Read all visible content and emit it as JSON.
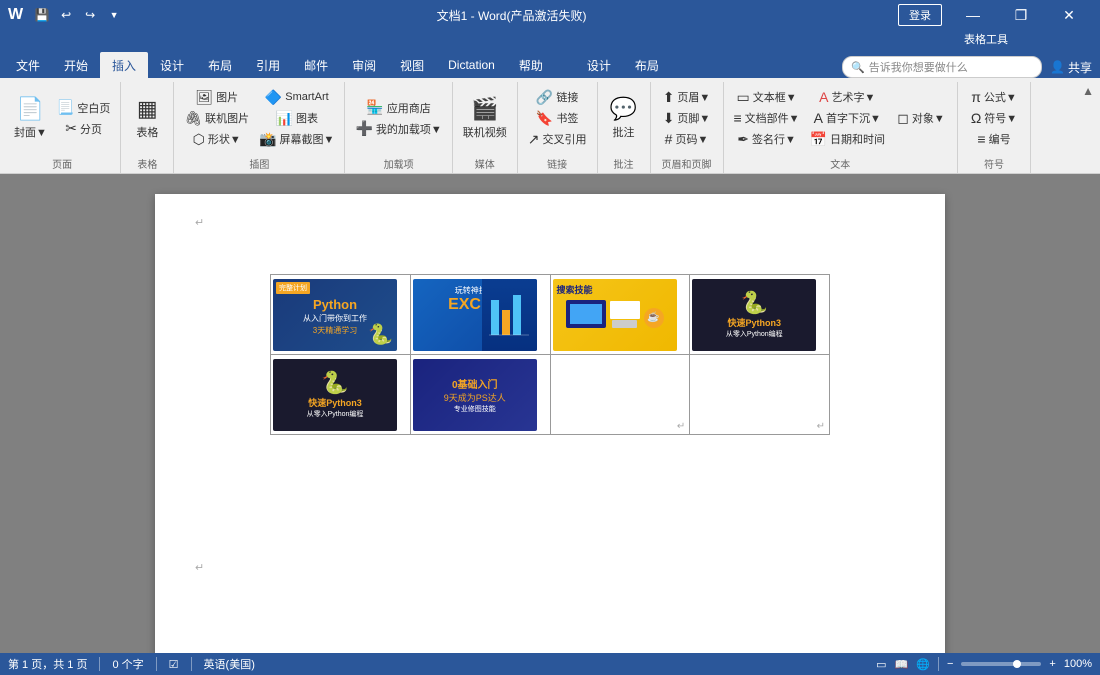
{
  "titlebar": {
    "title": "文档1 - Word(产品激活失败)",
    "table_tools": "表格工具",
    "login_label": "登录",
    "share_label": "共享",
    "minimize": "—",
    "restore": "❐",
    "close": "✕"
  },
  "qat": {
    "save": "💾",
    "undo": "↩",
    "redo": "↪",
    "custom": "▼"
  },
  "ribbon_tabs": {
    "file": "文件",
    "home": "开始",
    "insert": "插入",
    "design": "设计",
    "layout": "布局",
    "references": "引用",
    "mailings": "邮件",
    "review": "审阅",
    "view": "视图",
    "dictation": "Dictation",
    "help": "帮助",
    "table_design": "设计",
    "table_layout": "布局",
    "search_placeholder": "告诉我你想要做什么"
  },
  "ribbon": {
    "groups": [
      {
        "label": "页面",
        "items": [
          {
            "icon": "📄",
            "text": "封面▼",
            "type": "big"
          },
          {
            "icon": "📃",
            "text": "空白页",
            "type": "small"
          },
          {
            "icon": "✂",
            "text": "分页",
            "type": "small"
          }
        ]
      },
      {
        "label": "表格",
        "items": [
          {
            "icon": "▦",
            "text": "表格",
            "type": "big"
          }
        ]
      },
      {
        "label": "插图",
        "items": [
          {
            "icon": "🖼",
            "text": "图片",
            "type": "small"
          },
          {
            "icon": "🖇",
            "text": "联机图片",
            "type": "small"
          },
          {
            "icon": "⬡",
            "text": "形状▼",
            "type": "small"
          },
          {
            "icon": "🔷",
            "text": "SmartArt",
            "type": "small"
          },
          {
            "icon": "📊",
            "text": "图表",
            "type": "small"
          },
          {
            "icon": "📸",
            "text": "屏幕截图▼",
            "type": "small"
          }
        ]
      },
      {
        "label": "加载项",
        "items": [
          {
            "icon": "🏪",
            "text": "应用商店",
            "type": "small"
          },
          {
            "icon": "➕",
            "text": "我的加载项▼",
            "type": "small"
          }
        ]
      },
      {
        "label": "媒体",
        "items": [
          {
            "icon": "🎬",
            "text": "联机视频",
            "type": "big"
          }
        ]
      },
      {
        "label": "链接",
        "items": [
          {
            "icon": "🔗",
            "text": "链接",
            "type": "small"
          },
          {
            "icon": "🔖",
            "text": "书签",
            "type": "small"
          },
          {
            "icon": "↗",
            "text": "交叉引用",
            "type": "small"
          }
        ]
      },
      {
        "label": "批注",
        "items": [
          {
            "icon": "💬",
            "text": "批注",
            "type": "big"
          }
        ]
      },
      {
        "label": "页眉和页脚",
        "items": [
          {
            "icon": "⬆",
            "text": "页眉▼",
            "type": "small"
          },
          {
            "icon": "⬇",
            "text": "页脚▼",
            "type": "small"
          },
          {
            "icon": "#",
            "text": "页码▼",
            "type": "small"
          }
        ]
      },
      {
        "label": "文本",
        "items": [
          {
            "icon": "▭",
            "text": "文本框▼",
            "type": "small"
          },
          {
            "icon": "A",
            "text": "艺术字▼",
            "type": "small"
          },
          {
            "icon": "A",
            "text": "首字下沉▼",
            "type": "small"
          },
          {
            "icon": "≡",
            "text": "文档部件▼",
            "type": "small"
          },
          {
            "icon": "✒",
            "text": "签名行▼",
            "type": "small"
          },
          {
            "icon": "📅",
            "text": "日期和时间",
            "type": "small"
          },
          {
            "icon": "◻",
            "text": "对象▼",
            "type": "small"
          }
        ]
      },
      {
        "label": "符号",
        "items": [
          {
            "icon": "π",
            "text": "公式▼",
            "type": "small"
          },
          {
            "icon": "Ω",
            "text": "符号▼",
            "type": "small"
          },
          {
            "icon": "≡",
            "text": "编号",
            "type": "small"
          }
        ]
      }
    ]
  },
  "document": {
    "table": {
      "rows": 2,
      "cols": 4
    }
  },
  "statusbar": {
    "page_info": "第 1 页，共 1 页",
    "word_count": "0 个字",
    "language": "英语(美国)",
    "zoom": "100%",
    "zoom_value": 100
  },
  "cards": [
    {
      "type": "python",
      "title": "Python",
      "sub": "从入门带你到工作",
      "badge": "完整计划",
      "days": "3天"
    },
    {
      "type": "excel",
      "title": "EXCEL",
      "sub": "玩转神技能"
    },
    {
      "type": "search",
      "title": "搜索技能"
    },
    {
      "type": "python3dark",
      "title": "快速Python3"
    },
    {
      "type": "python3dark2",
      "title": "快速Python3"
    },
    {
      "type": "ps",
      "title": "0基础入门",
      "days": "9天成为PS达人"
    },
    {
      "type": "empty",
      "title": ""
    },
    {
      "type": "empty",
      "title": ""
    }
  ]
}
